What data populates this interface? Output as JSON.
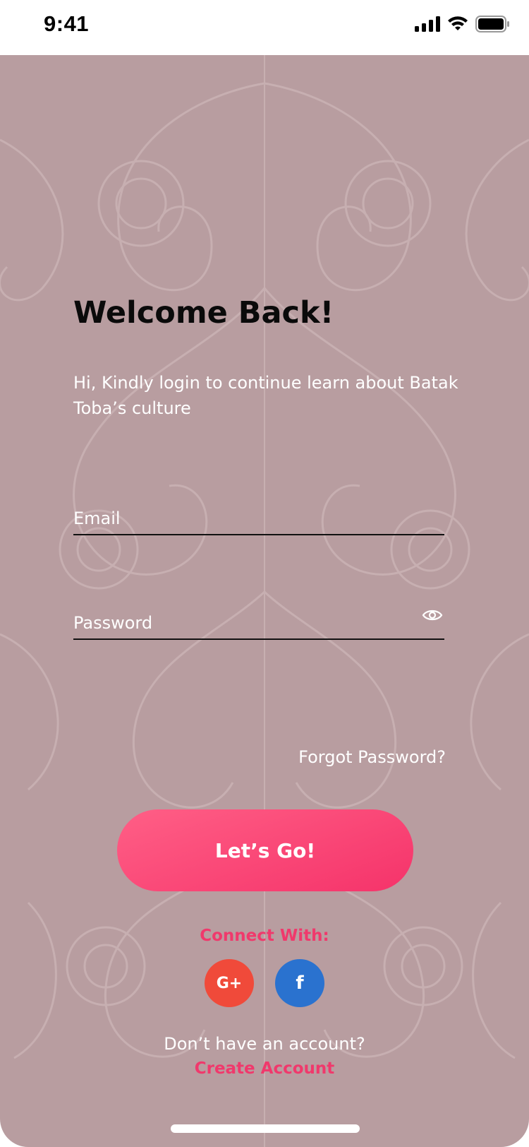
{
  "status_bar": {
    "time": "9:41",
    "icons": [
      "signal-icon",
      "wifi-icon",
      "battery-icon"
    ]
  },
  "login": {
    "title": "Welcome Back!",
    "subtitle": "Hi, Kindly login to continue learn about Batak Toba’s culture",
    "email_placeholder": "Email",
    "email_value": "",
    "password_placeholder": "Password",
    "password_value": "",
    "forgot_password": "Forgot Password?",
    "submit_label": "Let’s Go!"
  },
  "social": {
    "heading": "Connect With:",
    "google_label": "G+",
    "facebook_label": "f"
  },
  "footer": {
    "no_account_text": "Don’t have an account?",
    "create_account": "Create Account"
  },
  "colors": {
    "background": "#b89da0",
    "accent": "#f0396c",
    "google": "#f04a3a",
    "facebook": "#2a72cf"
  }
}
